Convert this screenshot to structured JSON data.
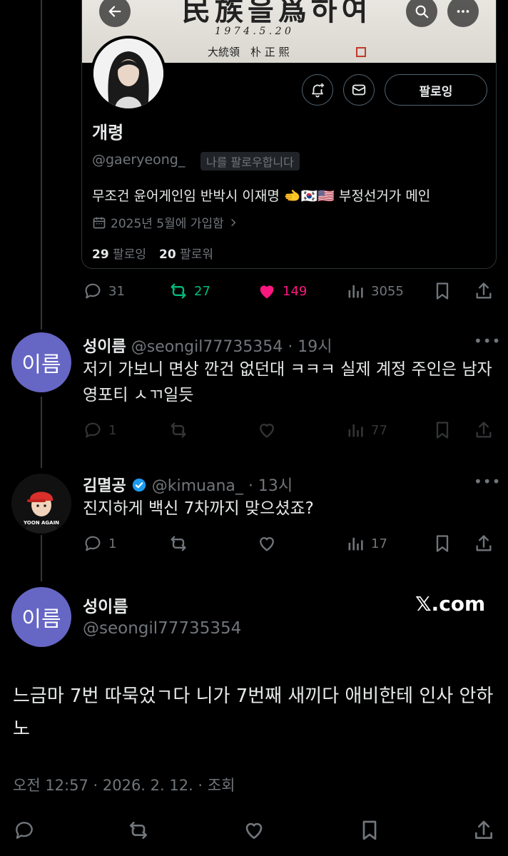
{
  "profile_card": {
    "banner_line1": "民族을爲하여",
    "banner_date": "1 9 7 4 . 5 . 2 0",
    "banner_sign": "大統領　朴 正 熙",
    "name": "개령",
    "handle": "@gaeryeong_",
    "follows_you": "나를 팔로우합니다",
    "bio": "무조건 윤어게인임 반박시 이재명 🫲🇰🇷🇺🇸 부정선거가 메인",
    "joined": "2025년 5월에 가입함",
    "following_count": "29",
    "following_label": "팔로잉",
    "followers_count": "20",
    "followers_label": "팔로워",
    "follow_button": "팔로잉"
  },
  "post_actions": {
    "replies": "31",
    "reposts": "27",
    "likes": "149",
    "views": "3055"
  },
  "replies": [
    {
      "avatar_text": "이름",
      "name": "성이름",
      "handle": "@seongil77735354",
      "time": "· 19시",
      "text": "저기 가보니 면상 깐건 없던대 ㅋㅋㅋ 실제 계정 주인은 남자 영포티 ㅅㄲ일듯",
      "replies": "1",
      "views": "77"
    },
    {
      "name": "김멸공",
      "handle": "@kimuana_",
      "time": "· 13시",
      "text": "진지하게 백신 7차까지 맞으셨죠?",
      "replies": "1",
      "views": "17",
      "avatar_text": "YOON AGAIN"
    }
  ],
  "main_post": {
    "avatar_text": "이름",
    "name": "성이름",
    "handle": "@seongil77735354",
    "source": "𝕏.com",
    "text": "느금마 7번 따묵었ㄱ다 니가 7번째 새끼다 애비한테 인사 안하노",
    "timestamp": "오전 12:57 · 2026. 2. 12. · 조회"
  },
  "colors": {
    "background": "#000000",
    "text": "#e7e9ea",
    "muted": "#71767b",
    "repost_green": "#00ba7c",
    "like_pink": "#f91880",
    "verified_blue": "#1d9bf0",
    "avatar_purple": "#6666c4"
  }
}
